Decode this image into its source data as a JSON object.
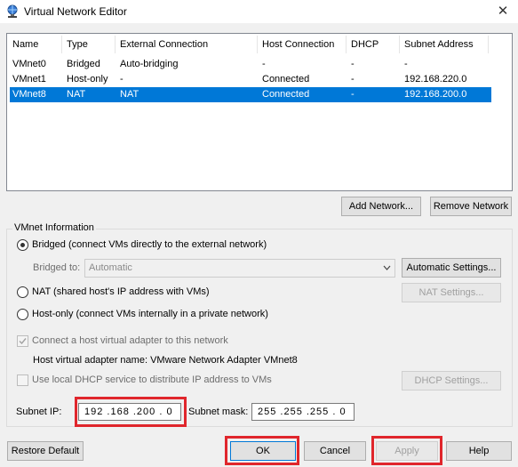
{
  "window": {
    "title": "Virtual Network Editor",
    "close_glyph": "✕",
    "icon": "network-globe-icon"
  },
  "network_list": {
    "columns": [
      "Name",
      "Type",
      "External Connection",
      "Host Connection",
      "DHCP",
      "Subnet Address"
    ],
    "rows": [
      {
        "name": "VMnet0",
        "type": "Bridged",
        "external": "Auto-bridging",
        "host": "-",
        "dhcp": "-",
        "subnet": "-"
      },
      {
        "name": "VMnet1",
        "type": "Host-only",
        "external": "-",
        "host": "Connected",
        "dhcp": "-",
        "subnet": "192.168.220.0"
      },
      {
        "name": "VMnet8",
        "type": "NAT",
        "external": "NAT",
        "host": "Connected",
        "dhcp": "-",
        "subnet": "192.168.200.0"
      }
    ],
    "selected_index": 2,
    "selection_color": "#0078d7"
  },
  "list_buttons": {
    "add": "Add Network...",
    "remove": "Remove Network"
  },
  "vmnet_info": {
    "group_label": "VMnet Information",
    "bridged_label": "Bridged (connect VMs directly to the external network)",
    "bridged_to_label": "Bridged to:",
    "bridged_to_value": "Automatic",
    "auto_settings": "Automatic Settings...",
    "nat_label": "NAT (shared host's IP address with VMs)",
    "nat_settings": "NAT Settings...",
    "hostonly_label": "Host-only (connect VMs internally in a private network)",
    "connect_adapter_label": "Connect a host virtual adapter to this network",
    "adapter_name_label": "Host virtual adapter name: VMware Network Adapter VMnet8",
    "dhcp_label": "Use local DHCP service to distribute IP address to VMs",
    "dhcp_settings": "DHCP Settings...",
    "subnet_ip_label": "Subnet IP:",
    "subnet_ip_value": "192 .168 .200 . 0",
    "subnet_mask_label": "Subnet mask:",
    "subnet_mask_value": "255 .255 .255 . 0",
    "selected_mode": "bridged"
  },
  "footer": {
    "restore": "Restore Default",
    "ok": "OK",
    "cancel": "Cancel",
    "apply": "Apply",
    "help": "Help"
  },
  "highlight_color": "#e0262c"
}
